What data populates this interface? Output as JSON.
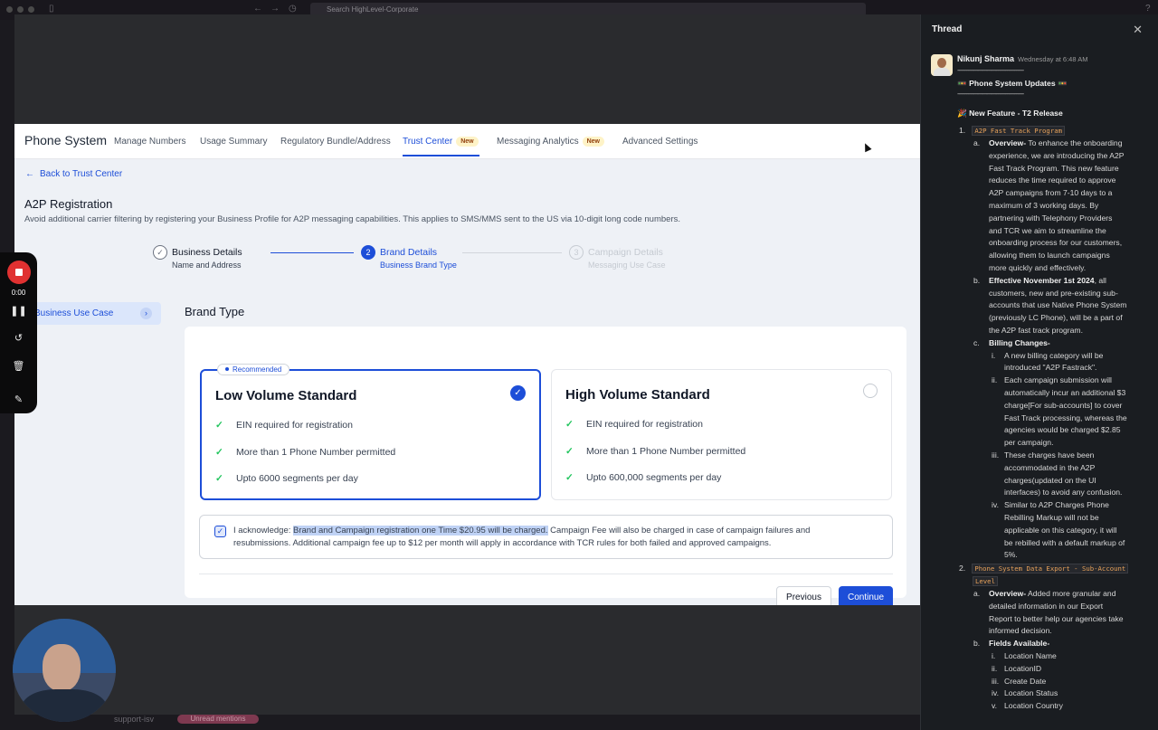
{
  "topbar": {
    "search_placeholder": "Search HighLevel-Corporate"
  },
  "app": {
    "brand": "Phone System",
    "nav": [
      {
        "label": "Manage Numbers"
      },
      {
        "label": "Usage Summary"
      },
      {
        "label": "Regulatory Bundle/Address"
      },
      {
        "label": "Trust Center",
        "badge": "New",
        "active": true
      },
      {
        "label": "Messaging Analytics",
        "badge": "New"
      },
      {
        "label": "Advanced Settings"
      }
    ],
    "back_link": "Back to Trust Center",
    "title": "A2P Registration",
    "subtitle": "Avoid additional carrier filtering by registering your Business Profile for A2P messaging capabilities. This applies to SMS/MMS sent to the US via 10-digit long code numbers.",
    "steps": [
      {
        "num": "✓",
        "label": "Business Details",
        "sub": "Name and Address"
      },
      {
        "num": "2",
        "label": "Brand Details",
        "sub": "Business Brand Type"
      },
      {
        "num": "3",
        "label": "Campaign Details",
        "sub": "Messaging Use Case"
      }
    ],
    "side_tab": "Business Use Case",
    "brand_type_heading": "Brand Type",
    "options": [
      {
        "title": "Low Volume Standard",
        "recommended": "Recommended",
        "selected": true,
        "features": [
          "EIN required for registration",
          "More than 1 Phone Number permitted",
          "Upto 6000 segments per day"
        ]
      },
      {
        "title": "High Volume Standard",
        "selected": false,
        "features": [
          "EIN required for registration",
          "More than 1 Phone Number permitted",
          "Upto 600,000 segments per day"
        ]
      }
    ],
    "ack": {
      "prefix": "I acknowledge: ",
      "highlight": "Brand and Campaign registration one Time $20.95 will be charged.",
      "rest": " Campaign Fee will also be charged in case of campaign failures and resubmissions. Additional campaign fee up to $12 per month will apply in accordance with TCR rules for both failed and approved campaigns."
    },
    "buttons": {
      "previous": "Previous",
      "continue": "Continue"
    }
  },
  "recorder": {
    "time": "0:00"
  },
  "bottom": {
    "channel": "support-isv",
    "pill": "Unread mentions"
  },
  "thread": {
    "header": "Thread",
    "author": "Nikunj Sharma",
    "timestamp": "Wednesday at 6:48 AM",
    "divider": "--------------------------------------------",
    "heading": "🚥 Phone System Updates 🚥",
    "new_feature": "🎉 New Feature - T2 Release",
    "item1_code": "A2P Fast Track Program",
    "item2_code_a": "Phone System Data Export - Sub-Account",
    "item2_code_b": "Level",
    "lines": [
      {
        "p": "a.",
        "b": "Overview-",
        "t": " To enhance the onboarding"
      },
      {
        "t": "experience, we are introducing the A2P"
      },
      {
        "t": "Fast Track Program. This new feature"
      },
      {
        "t": "reduces the time required to approve"
      },
      {
        "t": "A2P campaigns from 7-10 days to a"
      },
      {
        "t": "maximum of 3 working days. By"
      },
      {
        "t": "partnering with Telephony Providers"
      },
      {
        "t": "and TCR we aim to streamline the"
      },
      {
        "t": "onboarding process for our customers,"
      },
      {
        "t": "allowing them to launch campaigns"
      },
      {
        "t": "more quickly and effectively."
      },
      {
        "p": "b.",
        "b": "Effective November 1st 2024",
        "t": ", all"
      },
      {
        "t": "customers, new and pre-existing sub-"
      },
      {
        "t": "accounts that use Native Phone System"
      },
      {
        "t": "(previously LC Phone), will be a part of"
      },
      {
        "t": "the A2P fast track program."
      },
      {
        "p": "c.",
        "b": "Billing Changes-",
        "t": ""
      },
      {
        "p2": "i.",
        "t": "A new billing category will be"
      },
      {
        "i2": true,
        "t": "introduced \"A2P Fastrack\"."
      },
      {
        "p2": "ii.",
        "t": "Each campaign submission will"
      },
      {
        "i2": true,
        "t": "automatically incur an additional $3"
      },
      {
        "i2": true,
        "t": "charge[For sub-accounts] to cover"
      },
      {
        "i2": true,
        "t": "Fast Track processing, whereas the"
      },
      {
        "i2": true,
        "t": "agencies would be charged $2.85"
      },
      {
        "i2": true,
        "t": "per campaign."
      },
      {
        "p2": "iii.",
        "t": "These charges have been"
      },
      {
        "i2": true,
        "t": "accommodated in the A2P"
      },
      {
        "i2": true,
        "t": "charges(updated on the UI"
      },
      {
        "i2": true,
        "t": "interfaces) to avoid any confusion."
      },
      {
        "p2": "iv.",
        "t": "Similar to A2P Charges Phone"
      },
      {
        "i2": true,
        "t": "Rebilling Markup will not be"
      },
      {
        "i2": true,
        "t": "applicable on this category, it will"
      },
      {
        "i2": true,
        "t": "be rebilled with a default markup of"
      },
      {
        "i2": true,
        "t": "5%."
      }
    ],
    "lines2": [
      {
        "p": "a.",
        "b": "Overview-",
        "t": " Added more granular and"
      },
      {
        "t": "detailed information in our Export"
      },
      {
        "t": "Report to better help our agencies take"
      },
      {
        "t": "informed decision."
      },
      {
        "p": "b.",
        "b": "Fields Available-",
        "t": ""
      },
      {
        "p2": "i.",
        "t": "Location Name"
      },
      {
        "p2": "ii.",
        "t": "LocationID"
      },
      {
        "p2": "iii.",
        "t": "Create Date"
      },
      {
        "p2": "iv.",
        "t": "Location Status"
      },
      {
        "p2": "v.",
        "t": "Location Country"
      }
    ]
  }
}
